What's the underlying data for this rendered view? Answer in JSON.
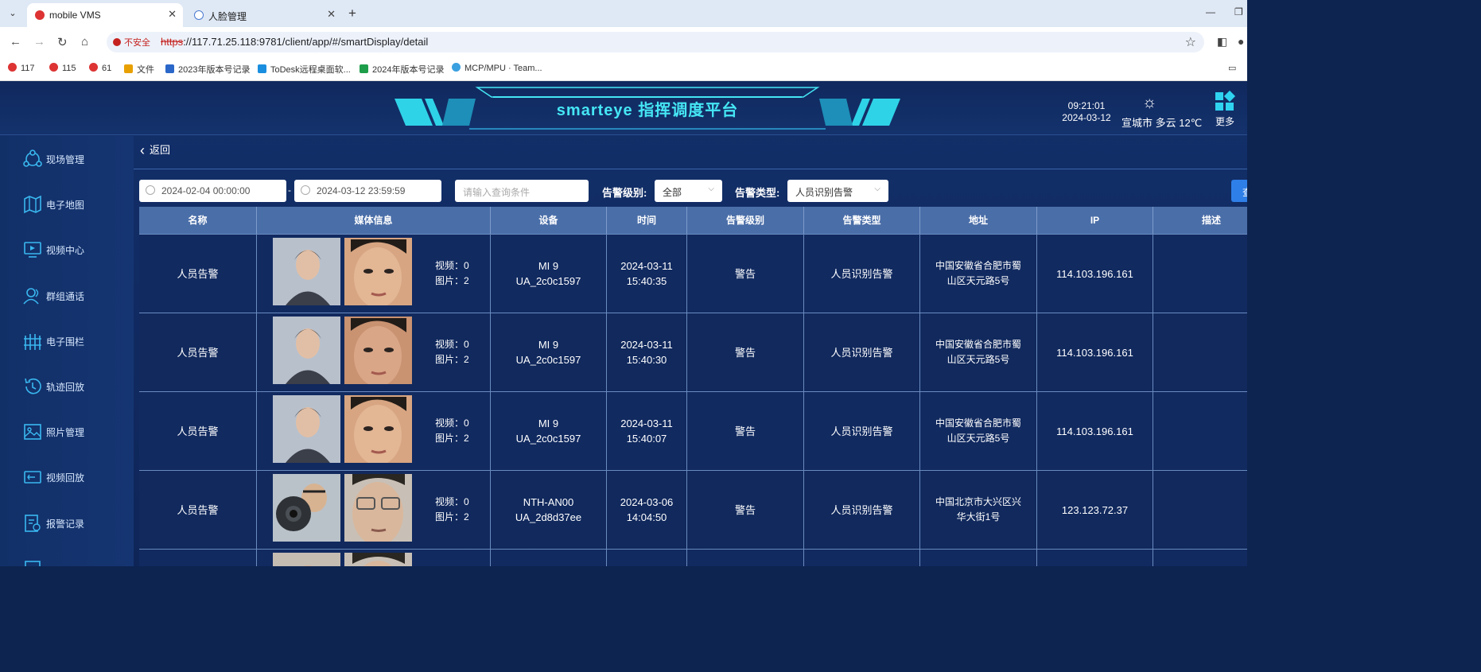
{
  "browser": {
    "tabs": [
      {
        "title": "mobile VMS",
        "active": true
      },
      {
        "title": "人脸管理",
        "active": false
      }
    ],
    "security_label": "不安全",
    "url_scheme": "https",
    "url_rest": "://117.71.25.118:9781/client/app/#/smartDisplay/detail",
    "bookmarks": [
      "117",
      "115",
      "61",
      "文件",
      "2023年版本号记录",
      "ToDesk远程桌面软...",
      "2024年版本号记录",
      "MCP/MPU · Team..."
    ]
  },
  "header": {
    "title": "smarteye 指挥调度平台",
    "time": "09:21:01",
    "date": "2024-03-12",
    "weather": "宣城市 多云 12℃",
    "more_label": "更多"
  },
  "sidebar": {
    "items": [
      {
        "label": "现场管理",
        "icon": "site-icon"
      },
      {
        "label": "电子地图",
        "icon": "map-icon"
      },
      {
        "label": "视频中心",
        "icon": "monitor-icon"
      },
      {
        "label": "群组通话",
        "icon": "group-call-icon"
      },
      {
        "label": "电子围栏",
        "icon": "fence-icon"
      },
      {
        "label": "轨迹回放",
        "icon": "history-icon"
      },
      {
        "label": "照片管理",
        "icon": "image-icon"
      },
      {
        "label": "视频回放",
        "icon": "video-replay-icon"
      },
      {
        "label": "报警记录",
        "icon": "alarm-record-icon"
      }
    ]
  },
  "main": {
    "back_label": "返回",
    "filters": {
      "start_time": "2024-02-04 00:00:00",
      "end_time": "2024-03-12 23:59:59",
      "search_placeholder": "请输入查询条件",
      "level_label": "告警级别:",
      "level_value": "全部",
      "type_label": "告警类型:",
      "type_value": "人员识别告警",
      "query_label": "查"
    },
    "table": {
      "columns": [
        "名称",
        "媒体信息",
        "设备",
        "时间",
        "告警级别",
        "告警类型",
        "地址",
        "IP",
        "描述"
      ],
      "rows": [
        {
          "name": "人员告警",
          "video": "视频：0",
          "photo": "图片：2",
          "device1": "MI 9",
          "device2": "UA_2c0c1597",
          "date": "2024-03-11",
          "time": "15:40:35",
          "level": "警告",
          "type": "人员识别告警",
          "addr1": "中国安徽省合肥市蜀",
          "addr2": "山区天元路5号",
          "ip": "114.103.196.161",
          "desc": ""
        },
        {
          "name": "人员告警",
          "video": "视频：0",
          "photo": "图片：2",
          "device1": "MI 9",
          "device2": "UA_2c0c1597",
          "date": "2024-03-11",
          "time": "15:40:30",
          "level": "警告",
          "type": "人员识别告警",
          "addr1": "中国安徽省合肥市蜀",
          "addr2": "山区天元路5号",
          "ip": "114.103.196.161",
          "desc": ""
        },
        {
          "name": "人员告警",
          "video": "视频：0",
          "photo": "图片：2",
          "device1": "MI 9",
          "device2": "UA_2c0c1597",
          "date": "2024-03-11",
          "time": "15:40:07",
          "level": "警告",
          "type": "人员识别告警",
          "addr1": "中国安徽省合肥市蜀",
          "addr2": "山区天元路5号",
          "ip": "114.103.196.161",
          "desc": ""
        },
        {
          "name": "人员告警",
          "video": "视频：0",
          "photo": "图片：2",
          "device1": "NTH-AN00",
          "device2": "UA_2d8d37ee",
          "date": "2024-03-06",
          "time": "14:04:50",
          "level": "警告",
          "type": "人员识别告警",
          "addr1": "中国北京市大兴区兴",
          "addr2": "华大街1号",
          "ip": "123.123.72.37",
          "desc": ""
        }
      ]
    }
  }
}
